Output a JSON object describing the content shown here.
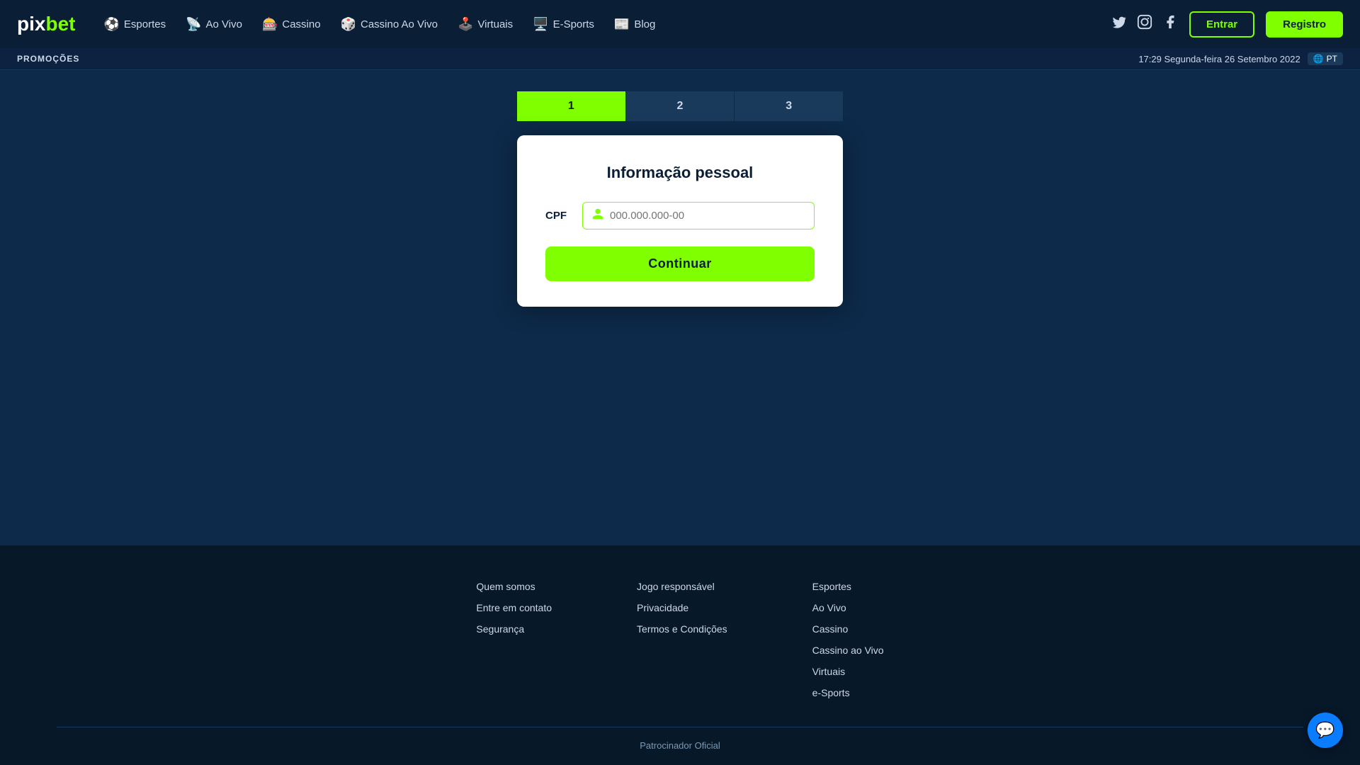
{
  "logo": {
    "pix": "pix",
    "bet": "bet"
  },
  "nav": {
    "items": [
      {
        "id": "esportes",
        "label": "Esportes",
        "icon": "⚽"
      },
      {
        "id": "ao-vivo",
        "label": "Ao Vivo",
        "icon": "📡"
      },
      {
        "id": "cassino",
        "label": "Cassino",
        "icon": "🎰"
      },
      {
        "id": "cassino-ao-vivo",
        "label": "Cassino Ao Vivo",
        "icon": "🎲"
      },
      {
        "id": "virtuais",
        "label": "Virtuais",
        "icon": "🕹️"
      },
      {
        "id": "e-sports",
        "label": "E-Sports",
        "icon": "🖥️"
      },
      {
        "id": "blog",
        "label": "Blog",
        "icon": "📰"
      }
    ],
    "btn_entrar": "Entrar",
    "btn_registro": "Registro"
  },
  "promo_bar": {
    "label": "PROMOÇÕES",
    "datetime": "17:29 Segunda-feira 26 Setembro 2022",
    "lang": "PT"
  },
  "steps": [
    {
      "id": 1,
      "label": "1",
      "active": true
    },
    {
      "id": 2,
      "label": "2",
      "active": false
    },
    {
      "id": 3,
      "label": "3",
      "active": false
    }
  ],
  "form": {
    "title": "Informação pessoal",
    "cpf_label": "CPF",
    "cpf_placeholder": "000.000.000-00",
    "submit_label": "Continuar"
  },
  "footer": {
    "col1": {
      "links": [
        {
          "label": "Quem somos"
        },
        {
          "label": "Entre em contato"
        },
        {
          "label": "Segurança"
        }
      ]
    },
    "col2": {
      "links": [
        {
          "label": "Jogo responsável"
        },
        {
          "label": "Privacidade"
        },
        {
          "label": "Termos e Condições"
        }
      ]
    },
    "col3": {
      "links": [
        {
          "label": "Esportes"
        },
        {
          "label": "Ao Vivo"
        },
        {
          "label": "Cassino"
        },
        {
          "label": "Cassino ao Vivo"
        },
        {
          "label": "Virtuais"
        },
        {
          "label": "e-Sports"
        }
      ]
    },
    "bottom": "Patrocinador Oficial"
  }
}
